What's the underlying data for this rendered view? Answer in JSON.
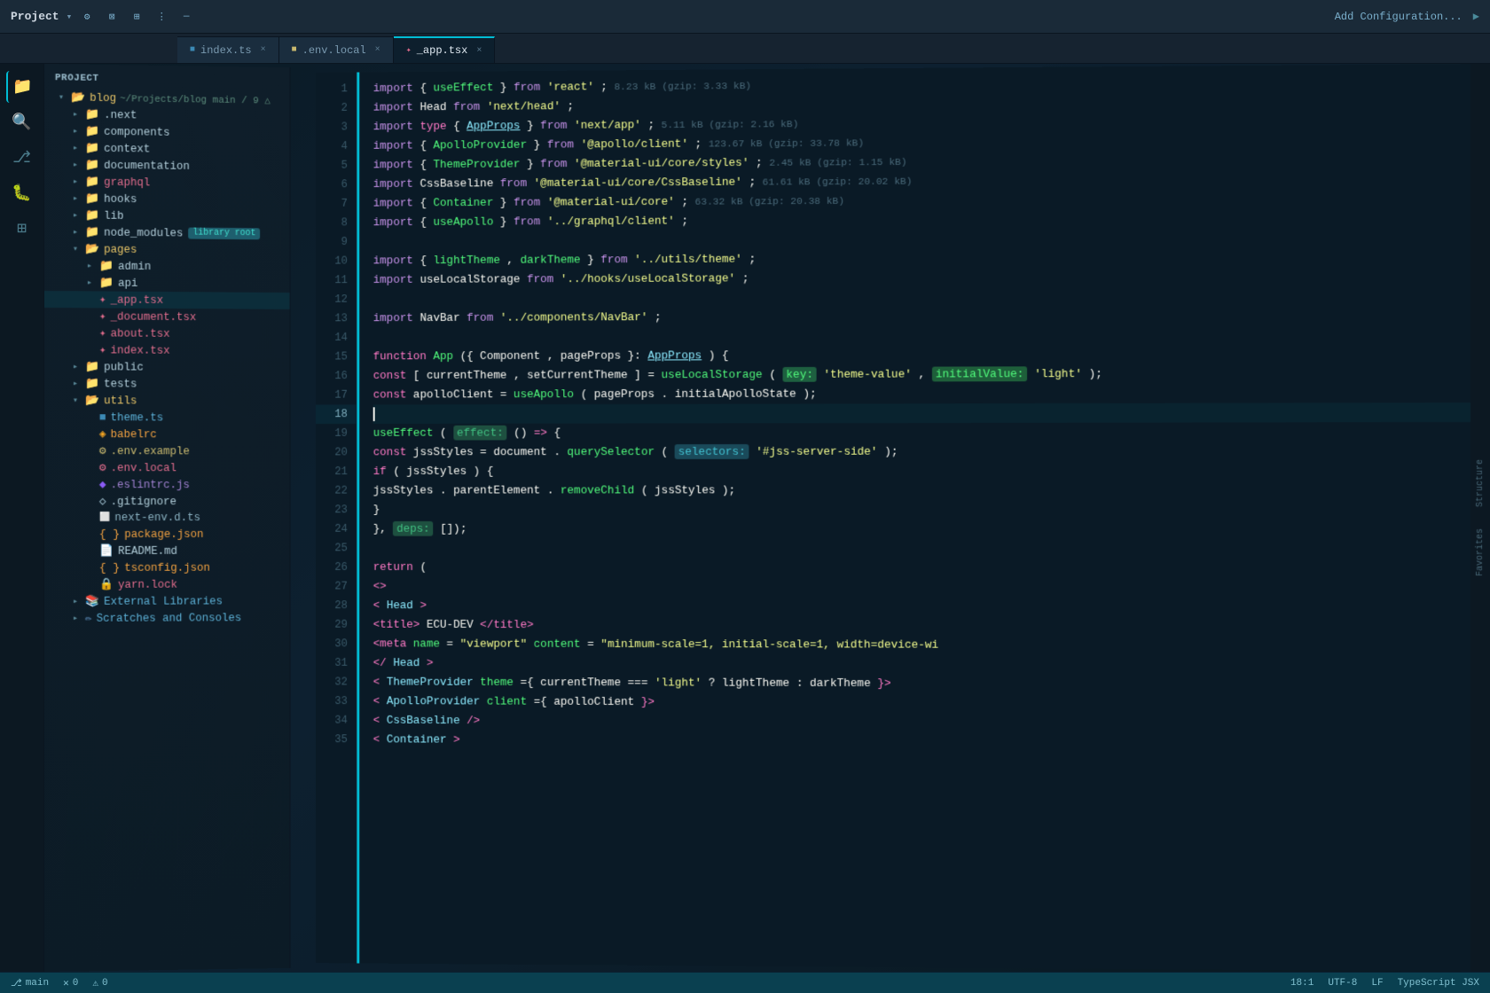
{
  "titleBar": {
    "projectName": "Project",
    "branchInfo": "~/Projects/blog main / 9 △",
    "addConfig": "Add Configuration...",
    "icons": [
      "⊙",
      "⊠",
      "⊞",
      "⋮",
      "—"
    ]
  },
  "tabs": [
    {
      "id": "index-ts",
      "label": "index.ts",
      "type": "ts",
      "active": false
    },
    {
      "id": "env-local",
      "label": ".env.local",
      "type": "env",
      "active": false
    },
    {
      "id": "app-tsx",
      "label": "_app.tsx",
      "type": "tsx",
      "active": true
    }
  ],
  "sidebar": {
    "header": "PROJECT",
    "items": [
      {
        "indent": 1,
        "label": "blog",
        "type": "folder-open",
        "info": "~/Projects/blog main / 9 △"
      },
      {
        "indent": 2,
        "label": ".next",
        "type": "folder"
      },
      {
        "indent": 2,
        "label": "components",
        "type": "folder"
      },
      {
        "indent": 2,
        "label": "context",
        "type": "folder"
      },
      {
        "indent": 2,
        "label": "documentation",
        "type": "folder"
      },
      {
        "indent": 2,
        "label": "graphql",
        "type": "folder-pink"
      },
      {
        "indent": 2,
        "label": "hooks",
        "type": "folder"
      },
      {
        "indent": 2,
        "label": "lib",
        "type": "folder"
      },
      {
        "indent": 2,
        "label": "node_modules",
        "type": "folder",
        "badge": "library root"
      },
      {
        "indent": 2,
        "label": "pages",
        "type": "folder-open"
      },
      {
        "indent": 3,
        "label": "admin",
        "type": "folder"
      },
      {
        "indent": 3,
        "label": "api",
        "type": "folder"
      },
      {
        "indent": 3,
        "label": "_app.tsx",
        "type": "tsx"
      },
      {
        "indent": 3,
        "label": "_document.tsx",
        "type": "tsx"
      },
      {
        "indent": 3,
        "label": "about.tsx",
        "type": "tsx"
      },
      {
        "indent": 3,
        "label": "index.tsx",
        "type": "tsx"
      },
      {
        "indent": 2,
        "label": "public",
        "type": "folder"
      },
      {
        "indent": 2,
        "label": "tests",
        "type": "folder"
      },
      {
        "indent": 2,
        "label": "utils",
        "type": "folder-open"
      },
      {
        "indent": 3,
        "label": "theme.ts",
        "type": "ts"
      },
      {
        "indent": 3,
        "label": "babelrc",
        "type": "babelrc"
      },
      {
        "indent": 3,
        "label": ".env.example",
        "type": "env"
      },
      {
        "indent": 3,
        "label": ".env.local",
        "type": "env-pink"
      },
      {
        "indent": 3,
        "label": ".eslintrc.js",
        "type": "eslint"
      },
      {
        "indent": 3,
        "label": ".gitignore",
        "type": "gitignore"
      },
      {
        "indent": 3,
        "label": "next-env.d.ts",
        "type": "ts-special"
      },
      {
        "indent": 3,
        "label": "package.json",
        "type": "json"
      },
      {
        "indent": 3,
        "label": "README.md",
        "type": "md"
      },
      {
        "indent": 3,
        "label": "tsconfig.json",
        "type": "json"
      },
      {
        "indent": 3,
        "label": "yarn.lock",
        "type": "lock"
      },
      {
        "indent": 2,
        "label": "External Libraries",
        "type": "folder-special"
      },
      {
        "indent": 2,
        "label": "Scratches and Consoles",
        "type": "folder-special"
      }
    ]
  },
  "codeLines": [
    {
      "num": 1,
      "code": "import_useEffect_react",
      "active": false
    },
    {
      "num": 2,
      "code": "import_Head_nexthead",
      "active": false
    },
    {
      "num": 3,
      "code": "import_type_AppProps_nextapp",
      "active": false
    },
    {
      "num": 4,
      "code": "import_ApolloProvider_apolloclient",
      "active": false
    },
    {
      "num": 5,
      "code": "import_ThemeProvider_materialui",
      "active": false
    },
    {
      "num": 6,
      "code": "import_CssBaseline_materialui",
      "active": false
    },
    {
      "num": 7,
      "code": "import_Container_materialui",
      "active": false
    },
    {
      "num": 8,
      "code": "import_useApollo_graphqlclient",
      "active": false
    },
    {
      "num": 9,
      "code": "blank",
      "active": false
    },
    {
      "num": 10,
      "code": "import_lightTheme_darkTheme_utils",
      "active": false
    },
    {
      "num": 11,
      "code": "import_useLocalStorage_hooks",
      "active": false
    },
    {
      "num": 12,
      "code": "blank",
      "active": false
    },
    {
      "num": 13,
      "code": "import_NavBar_components",
      "active": false
    },
    {
      "num": 14,
      "code": "blank",
      "active": false
    },
    {
      "num": 15,
      "code": "function_App_def",
      "active": false
    },
    {
      "num": 16,
      "code": "const_currentTheme",
      "active": false
    },
    {
      "num": 17,
      "code": "const_apolloClient",
      "active": false
    },
    {
      "num": 18,
      "code": "blank",
      "active": true
    },
    {
      "num": 19,
      "code": "useEffect_open",
      "active": false
    },
    {
      "num": 20,
      "code": "const_jssStyles",
      "active": false
    },
    {
      "num": 21,
      "code": "if_jssStyles",
      "active": false
    },
    {
      "num": 22,
      "code": "jssStyles_remove",
      "active": false
    },
    {
      "num": 23,
      "code": "if_close",
      "active": false
    },
    {
      "num": 24,
      "code": "useEffect_close",
      "active": false
    },
    {
      "num": 25,
      "code": "blank",
      "active": false
    },
    {
      "num": 26,
      "code": "return_open",
      "active": false
    },
    {
      "num": 27,
      "code": "jsx_open",
      "active": false
    },
    {
      "num": 28,
      "code": "jsx_Head",
      "active": false
    },
    {
      "num": 29,
      "code": "jsx_title",
      "active": false
    },
    {
      "num": 30,
      "code": "jsx_meta",
      "active": false
    },
    {
      "num": 31,
      "code": "jsx_Head_close",
      "active": false
    },
    {
      "num": 32,
      "code": "jsx_ThemeProvider",
      "active": false
    },
    {
      "num": 33,
      "code": "jsx_ApolloProvider",
      "active": false
    },
    {
      "num": 34,
      "code": "jsx_CssBaseline",
      "active": false
    },
    {
      "num": 35,
      "code": "jsx_Container",
      "active": false
    }
  ],
  "statusBar": {
    "branch": "main",
    "errors": "0",
    "warnings": "0",
    "line": "18:1",
    "encoding": "UTF-8",
    "lineEnding": "LF",
    "language": "TypeScript JSX"
  }
}
